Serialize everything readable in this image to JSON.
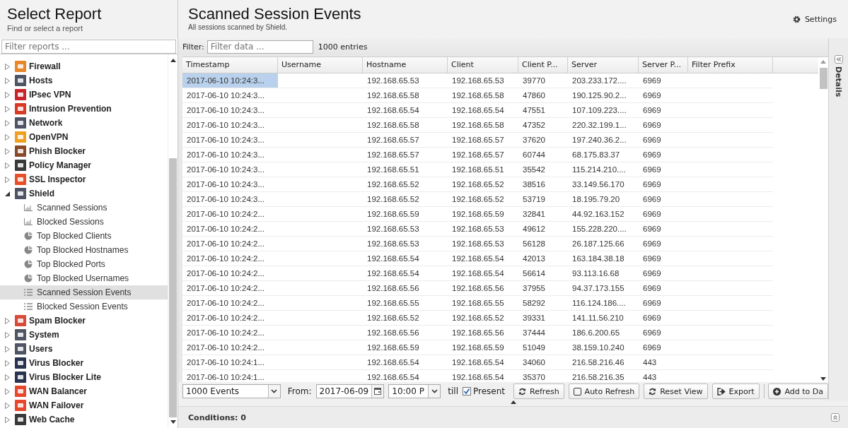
{
  "sidebar": {
    "title": "Select Report",
    "subtitle": "Find or select a report",
    "filter": {
      "placeholder": "Filter reports ..."
    },
    "items": [
      {
        "label": "Firewall",
        "color": "#e8862a",
        "expanded": false
      },
      {
        "label": "Hosts",
        "color": "#4f5564",
        "expanded": false
      },
      {
        "label": "IPsec VPN",
        "color": "#c8242a",
        "expanded": false
      },
      {
        "label": "Intrusion Prevention",
        "color": "#d83a24",
        "expanded": false
      },
      {
        "label": "Network",
        "color": "#4f5564",
        "expanded": false
      },
      {
        "label": "OpenVPN",
        "color": "#f0a020",
        "expanded": false
      },
      {
        "label": "Phish Blocker",
        "color": "#8a4a2a",
        "expanded": false
      },
      {
        "label": "Policy Manager",
        "color": "#3a3a3a",
        "expanded": false
      },
      {
        "label": "SSL Inspector",
        "color": "#e8502a",
        "expanded": false
      },
      {
        "label": "Shield",
        "color": "#4f5564",
        "expanded": true,
        "children": [
          {
            "label": "Scanned Sessions",
            "kind": "bar",
            "selected": false
          },
          {
            "label": "Blocked Sessions",
            "kind": "bar",
            "selected": false
          },
          {
            "label": "Top Blocked Clients",
            "kind": "pie",
            "selected": false
          },
          {
            "label": "Top Blocked Hostnames",
            "kind": "pie",
            "selected": false
          },
          {
            "label": "Top Blocked Ports",
            "kind": "pie",
            "selected": false
          },
          {
            "label": "Top Blocked Usernames",
            "kind": "pie",
            "selected": false
          },
          {
            "label": "Scanned Session Events",
            "kind": "list",
            "selected": true
          },
          {
            "label": "Blocked Session Events",
            "kind": "list",
            "selected": false
          }
        ]
      },
      {
        "label": "Spam Blocker",
        "color": "#d84a3a",
        "expanded": false
      },
      {
        "label": "System",
        "color": "#4f5564",
        "expanded": false
      },
      {
        "label": "Users",
        "color": "#4f5564",
        "expanded": false
      },
      {
        "label": "Virus Blocker",
        "color": "#2a3450",
        "expanded": false
      },
      {
        "label": "Virus Blocker Lite",
        "color": "#2a3450",
        "expanded": false
      },
      {
        "label": "WAN Balancer",
        "color": "#e8482a",
        "expanded": false
      },
      {
        "label": "WAN Failover",
        "color": "#e8482a",
        "expanded": false
      },
      {
        "label": "Web Cache",
        "color": "#3a3a3a",
        "expanded": false
      }
    ]
  },
  "header": {
    "title": "Scanned Session Events",
    "subtitle": "All sessions scanned by Shield.",
    "settings": "Settings"
  },
  "filter_bar": {
    "label": "Filter:",
    "placeholder": "Filter data ...",
    "count": "1000 entries"
  },
  "table": {
    "columns": [
      "Timestamp",
      "Username",
      "Hostname",
      "Client",
      "Client P...",
      "Server",
      "Server P...",
      "Filter Prefix"
    ],
    "rows": [
      {
        "selected": true,
        "cells": [
          "2017-06-10 10:24:3...",
          "",
          "192.168.65.53",
          "192.168.65.53",
          "39770",
          "203.233.172....",
          "6969",
          ""
        ]
      },
      {
        "selected": false,
        "cells": [
          "2017-06-10 10:24:3...",
          "",
          "192.168.65.58",
          "192.168.65.58",
          "47860",
          "190.125.90.2...",
          "6969",
          ""
        ]
      },
      {
        "selected": false,
        "cells": [
          "2017-06-10 10:24:3...",
          "",
          "192.168.65.54",
          "192.168.65.54",
          "47551",
          "107.109.223....",
          "6969",
          ""
        ]
      },
      {
        "selected": false,
        "cells": [
          "2017-06-10 10:24:3...",
          "",
          "192.168.65.58",
          "192.168.65.58",
          "47352",
          "220.32.199.1...",
          "6969",
          ""
        ]
      },
      {
        "selected": false,
        "cells": [
          "2017-06-10 10:24:3...",
          "",
          "192.168.65.57",
          "192.168.65.57",
          "37620",
          "197.240.36.2...",
          "6969",
          ""
        ]
      },
      {
        "selected": false,
        "cells": [
          "2017-06-10 10:24:3...",
          "",
          "192.168.65.57",
          "192.168.65.57",
          "60744",
          "68.175.83.37",
          "6969",
          ""
        ]
      },
      {
        "selected": false,
        "cells": [
          "2017-06-10 10:24:3...",
          "",
          "192.168.65.51",
          "192.168.65.51",
          "35542",
          "115.214.210....",
          "6969",
          ""
        ]
      },
      {
        "selected": false,
        "cells": [
          "2017-06-10 10:24:3...",
          "",
          "192.168.65.52",
          "192.168.65.52",
          "38516",
          "33.149.56.170",
          "6969",
          ""
        ]
      },
      {
        "selected": false,
        "cells": [
          "2017-06-10 10:24:3...",
          "",
          "192.168.65.52",
          "192.168.65.52",
          "53719",
          "18.195.79.20",
          "6969",
          ""
        ]
      },
      {
        "selected": false,
        "cells": [
          "2017-06-10 10:24:2...",
          "",
          "192.168.65.59",
          "192.168.65.59",
          "32841",
          "44.92.163.152",
          "6969",
          ""
        ]
      },
      {
        "selected": false,
        "cells": [
          "2017-06-10 10:24:2...",
          "",
          "192.168.65.53",
          "192.168.65.53",
          "49612",
          "155.228.220....",
          "6969",
          ""
        ]
      },
      {
        "selected": false,
        "cells": [
          "2017-06-10 10:24:2...",
          "",
          "192.168.65.53",
          "192.168.65.53",
          "56128",
          "26.187.125.66",
          "6969",
          ""
        ]
      },
      {
        "selected": false,
        "cells": [
          "2017-06-10 10:24:2...",
          "",
          "192.168.65.54",
          "192.168.65.54",
          "42013",
          "163.184.38.18",
          "6969",
          ""
        ]
      },
      {
        "selected": false,
        "cells": [
          "2017-06-10 10:24:2...",
          "",
          "192.168.65.54",
          "192.168.65.54",
          "56614",
          "93.113.16.68",
          "6969",
          ""
        ]
      },
      {
        "selected": false,
        "cells": [
          "2017-06-10 10:24:2...",
          "",
          "192.168.65.56",
          "192.168.65.56",
          "37955",
          "94.37.173.155",
          "6969",
          ""
        ]
      },
      {
        "selected": false,
        "cells": [
          "2017-06-10 10:24:2...",
          "",
          "192.168.65.55",
          "192.168.65.55",
          "58292",
          "116.124.186....",
          "6969",
          ""
        ]
      },
      {
        "selected": false,
        "cells": [
          "2017-06-10 10:24:2...",
          "",
          "192.168.65.52",
          "192.168.65.52",
          "39331",
          "141.11.56.210",
          "6969",
          ""
        ]
      },
      {
        "selected": false,
        "cells": [
          "2017-06-10 10:24:2...",
          "",
          "192.168.65.56",
          "192.168.65.56",
          "37444",
          "186.6.200.65",
          "6969",
          ""
        ]
      },
      {
        "selected": false,
        "cells": [
          "2017-06-10 10:24:2...",
          "",
          "192.168.65.59",
          "192.168.65.59",
          "51049",
          "38.159.10.240",
          "6969",
          ""
        ]
      },
      {
        "selected": false,
        "cells": [
          "2017-06-10 10:24:1...",
          "",
          "192.168.65.54",
          "192.168.65.54",
          "34060",
          "216.58.216.46",
          "443",
          ""
        ]
      },
      {
        "selected": false,
        "cells": [
          "2017-06-10 10:24:1...",
          "",
          "192.168.65.54",
          "192.168.65.54",
          "35370",
          "216.58.216.35",
          "443",
          ""
        ]
      }
    ]
  },
  "toolbar": {
    "limit": "1000 Events",
    "from_label": "From:",
    "date": "2017-06-09",
    "time": "10:00 P",
    "till": "till",
    "present": {
      "label": "Present",
      "checked": true
    },
    "buttons": [
      {
        "label": "Refresh",
        "kind": "refresh"
      },
      {
        "label": "Auto Refresh",
        "kind": "check"
      },
      {
        "label": "Reset View",
        "kind": "refresh"
      },
      {
        "label": "Export",
        "kind": "export"
      },
      {
        "label": "Add to Da",
        "kind": "add"
      }
    ]
  },
  "details": "Details",
  "conditions": "Conditions: 0"
}
